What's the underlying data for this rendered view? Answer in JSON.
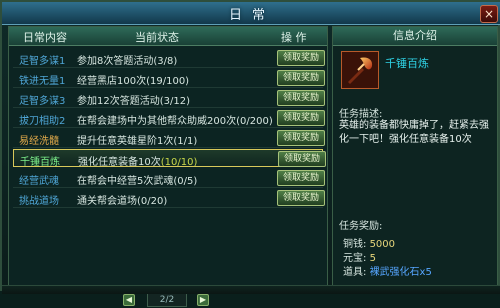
{
  "window": {
    "title": "日常",
    "close": "×"
  },
  "left": {
    "headers": [
      "日常内容",
      "当前状态",
      "操 作"
    ],
    "rows": [
      {
        "name": "足智多谋1",
        "status": "参加8次答题活动",
        "progress": "(3/8)",
        "button": "领取奖励",
        "type": "normal"
      },
      {
        "name": "铁进无量1",
        "status": "经营黑店100次",
        "progress": "(19/100)",
        "button": "领取奖励",
        "type": "normal"
      },
      {
        "name": "足智多谋3",
        "status": "参加12次答题活动",
        "progress": "(3/12)",
        "button": "领取奖励",
        "type": "normal"
      },
      {
        "name": "拔刀相助2",
        "status": "在帮会建场中为其他帮众助威200次",
        "progress": "(0/200)",
        "button": "领取奖励",
        "type": "normal"
      },
      {
        "name": "易经洗髓",
        "status": "提升任意英雄星阶1次",
        "progress": "(1/1)",
        "button": "领取奖励",
        "type": "gold"
      },
      {
        "name": "千锤百炼",
        "status": "强化任意装备10次",
        "progress": "(10/10)",
        "button": "领取奖励",
        "type": "selected"
      },
      {
        "name": "经营武魂",
        "status": "在帮会中经营5次武魂",
        "progress": "(0/5)",
        "button": "领取奖励",
        "type": "normal"
      },
      {
        "name": "挑战道场",
        "status": "通关帮会道场",
        "progress": "(0/20)",
        "button": "领取奖励",
        "type": "normal"
      }
    ],
    "pager": {
      "text": "2/2",
      "prev": "◀",
      "next": "▶"
    }
  },
  "right": {
    "header": "信息介绍",
    "item_name": "千锤百炼",
    "desc_label": "任务描述:",
    "desc_text": "英雄的装备都快庸掉了，赶紧去强化一下吧！强化任意装备10次",
    "reward_label": "任务奖励:",
    "rewards": [
      {
        "k": "铜钱:",
        "v": "5000"
      },
      {
        "k": "元宝:",
        "v": "5"
      },
      {
        "k": "道具:",
        "v": "裸武强化石x5"
      }
    ]
  },
  "colors": {
    "accent": "#2fd3e6",
    "gold": "#e0a94a",
    "selectedBorder": "#d8c85a"
  }
}
